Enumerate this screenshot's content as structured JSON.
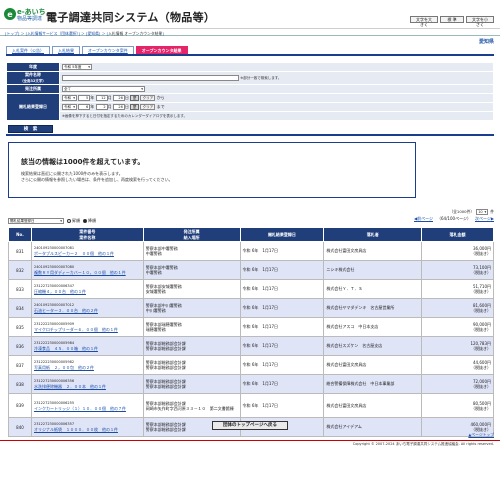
{
  "header": {
    "logo_line1": "e-あいち",
    "logo_line2": "物品等調達",
    "system_title": "電子調達共同システム（物品等）",
    "buttons": [
      "文字を大きく",
      "標 準",
      "文字を小さく"
    ]
  },
  "breadcrumb": {
    "items": [
      "トップ",
      "入札情報サービス（団体選択）",
      "愛知県"
    ],
    "current": "入札情報 オープンカウンタ結果"
  },
  "prefecture": "愛知県",
  "tabs": [
    "入札案件（公告）",
    "入札結果",
    "オープンカウンタ案件",
    "オープンカウンタ結果"
  ],
  "form": {
    "year_label": "年度",
    "year_value": "令和 5年度",
    "case_name_label": "案件名称",
    "case_name_sub": "（全角32文字）",
    "case_name_note": "※部分一致で検索します。",
    "dept_label": "発注所属",
    "dept_value": "全て",
    "date_label": "開札結果登録日",
    "era": "令和",
    "from_year": "5",
    "from_month": "12",
    "from_day": "26",
    "to_year": "6",
    "to_month": "2",
    "to_day": "26",
    "unit_year": "年",
    "unit_month": "月",
    "unit_day": "日",
    "cal_label": "歴",
    "from_label": "から",
    "to_label": "まで",
    "clear_label": "クリア",
    "cal_note": "※画像を押下すると日付を指定するためのカレンダーダイアログを表示します。"
  },
  "search_button": "検　索",
  "warning": {
    "title": "該当の情報は1000件を超えています。",
    "line1": "検索結果は直近に公開された1000件のみを表示します。",
    "line2": "さらに公開の情報を参照したい場合は、条件を追加し、再度検索を行ってください。"
  },
  "count": {
    "total": "（全1000件）",
    "per_page": "10",
    "per_page_unit": "件"
  },
  "sort": {
    "field": "開札結果登録日",
    "asc": "昇順",
    "desc": "降順"
  },
  "pager": {
    "prev": "前ページ",
    "page_info": "（64/100ページ）",
    "next": "次ページ"
  },
  "table": {
    "headers": {
      "no": "No.",
      "case": "案件番号\n案件名称",
      "org": "発注所属\n納入場所",
      "date": "開札結果登録日",
      "win": "落札者",
      "amt": "落札金額"
    },
    "rows": [
      {
        "no": "831",
        "num": "240109230000007081",
        "name": "ポータブルスピーカー２　００個　他の１件",
        "org1": "警察本部中署警務",
        "org2": "中署警務",
        "date": "令和 6年　1月17日",
        "win": "株式会社富田文房具店",
        "amt": "36,000円",
        "tax": "（税抜き）"
      },
      {
        "no": "832",
        "num": "240109230000007080",
        "name": "複数ＲＹ用ダディーカバー１０，００個　他の１件",
        "org1": "警察本部中署警務",
        "org2": "中署警務",
        "date": "令和 6年　1月17日",
        "win": "ニシキ株式会社",
        "amt": "73,100円",
        "tax": "（税抜き）"
      },
      {
        "no": "833",
        "num": "231227230000006347",
        "name": "圧縮機４，００台　他の１件",
        "org1": "警察本部安城署警務",
        "org2": "安城署警務",
        "date": "令和 6年　1月17日",
        "win": "株式会社Ｙ．Ｔ．Ｓ",
        "amt": "51,710円",
        "tax": "（税抜き）"
      },
      {
        "no": "834",
        "num": "240109230000007012",
        "name": "石油ヒーター３．００台　他の２件",
        "org1": "警察本部中川署警務",
        "org2": "中川署警務",
        "date": "令和 6年　1月17日",
        "win": "株式会社ヤマダデンキ　名古屋営業所",
        "amt": "81,600円",
        "tax": "（税抜き）"
      },
      {
        "no": "835",
        "num": "231222230000005909",
        "name": "マイクロチップリーダー６．００個　他の１件",
        "org1": "警察本部瑞穂署警務",
        "org2": "瑞穂署警務",
        "date": "令和 6年　1月17日",
        "win": "株式会社アスコ　中日本支店",
        "amt": "90,000円",
        "tax": "（税抜き）"
      },
      {
        "no": "836",
        "num": "231222230000005984",
        "name": "冷凍食品　４５．００箱　他の１件",
        "org1": "警察本部総務部会計課",
        "org2": "警察本部総務部会計課",
        "date": "令和 6年　1月17日",
        "win": "株式会社スズケン　名古屋支店",
        "amt": "120,783円",
        "tax": "（税抜き）"
      },
      {
        "no": "837",
        "num": "231222230000005982",
        "name": "写真用紙　２，００包　他の２件",
        "org1": "警察本部総務部会計課",
        "org2": "警察本部総務部会計課",
        "date": "令和 6年　1月17日",
        "win": "株式会社富田文房具店",
        "amt": "44,600円",
        "tax": "（税抜き）"
      },
      {
        "no": "838",
        "num": "231227230000006356",
        "name": "水洗排便除機器　２．００本　他の１件",
        "org1": "警察本部総務部会計課",
        "org2": "警察本部総務部会計課",
        "date": "令和 6年　1月17日",
        "win": "総合警備保障株式会社　中日本事業部",
        "amt": "72,000円",
        "tax": "（税抜き）"
      },
      {
        "no": "839",
        "num": "231227230000006255",
        "name": "インクカートリッジ（１）１０．００個　他の７件",
        "org1": "警察本部総務部会計課",
        "org2": "岡崎市矢作町字西河原３３－１０　第二文書館棟",
        "date": "令和 6年　1月17日",
        "win": "株式会社富田文房具店",
        "amt": "80,500円",
        "tax": "（税抜き）"
      },
      {
        "no": "840",
        "num": "231227230000006357",
        "name": "オリジナル紙袋　１０００．００枚　他の１件",
        "org1": "警察本部総務部会計課",
        "org2": "警察本部総務部会計課",
        "date": "令和 6年　1月17日",
        "win": "株式会社アイデアム",
        "amt": "460,000円",
        "tax": "（税抜き）"
      }
    ]
  },
  "bottom_button": "団体のトップページへ戻る",
  "top_link": "▲ページトップ",
  "footer": "Copyright © 2007-2024 あいち電子調達共同システム推進協議会. All rights reserved.",
  "colors": {
    "navy": "#1f3e7a",
    "tab_active": "#e6246a",
    "row_alt": "#dfe4f7",
    "link": "#1a4da8"
  }
}
